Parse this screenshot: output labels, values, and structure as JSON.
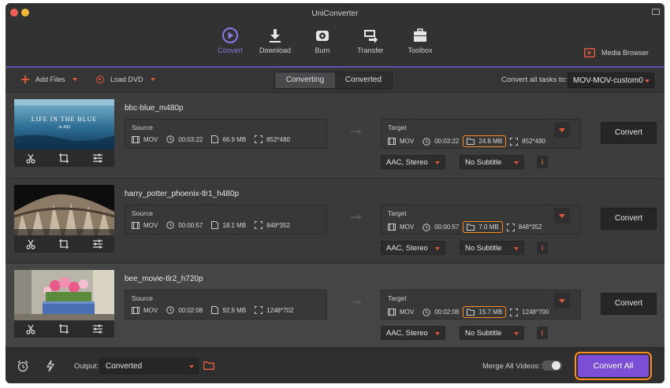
{
  "app": {
    "title": "UniConverter"
  },
  "nav": [
    {
      "label": "Convert",
      "icon": "convert-icon",
      "active": true
    },
    {
      "label": "Download",
      "icon": "download-icon",
      "active": false
    },
    {
      "label": "Burn",
      "icon": "burn-icon",
      "active": false
    },
    {
      "label": "Transfer",
      "icon": "transfer-icon",
      "active": false
    },
    {
      "label": "Toolbox",
      "icon": "toolbox-icon",
      "active": false
    }
  ],
  "media_browser": {
    "label": "Media Browser"
  },
  "actionbar": {
    "add_files": "Add Files",
    "load_dvd": "Load DVD",
    "tabs": [
      "Converting",
      "Converted"
    ],
    "convert_all_label": "Convert all tasks to:",
    "format": "MOV-MOV-custom0"
  },
  "tasks": [
    {
      "filename": "bbc-blue_m480p",
      "thumb_text": "LIFE IN THE BLUE",
      "thumb_sub": "in HD",
      "source": {
        "label": "Source",
        "format": "MOV",
        "duration": "00:03:22",
        "size": "66.9 MB",
        "resolution": "852*480"
      },
      "target": {
        "label": "Target",
        "format": "MOV",
        "duration": "00:03:22",
        "size": "24.8 MB",
        "resolution": "852*480"
      },
      "audio": "AAC, Stereo",
      "subtitle": "No Subtitle",
      "convert": "Convert"
    },
    {
      "filename": "harry_potter_phoenix-tlr1_h480p",
      "source": {
        "label": "Source",
        "format": "MOV",
        "duration": "00:00:57",
        "size": "18.1 MB",
        "resolution": "848*352"
      },
      "target": {
        "label": "Target",
        "format": "MOV",
        "duration": "00:00:57",
        "size": "7.0 MB",
        "resolution": "848*352"
      },
      "audio": "AAC, Stereo",
      "subtitle": "No Subtitle",
      "convert": "Convert"
    },
    {
      "filename": "bee_movie-tlr2_h720p",
      "source": {
        "label": "Source",
        "format": "MOV",
        "duration": "00:02:08",
        "size": "92.9 MB",
        "resolution": "1248*702"
      },
      "target": {
        "label": "Target",
        "format": "MOV",
        "duration": "00:02:08",
        "size": "15.7 MB",
        "resolution": "1248*700"
      },
      "audio": "AAC, Stereo",
      "subtitle": "No Subtitle",
      "convert": "Convert"
    }
  ],
  "info_glyph": "i",
  "bottom": {
    "output_label": "Output:",
    "output_value": "Converted",
    "merge_label": "Merge All Videos:",
    "merge_on": false,
    "convert_all": "Convert All"
  },
  "colors": {
    "accent": "#7a4fd6",
    "highlight": "#ff8a1e",
    "caret": "#e05a3a"
  }
}
